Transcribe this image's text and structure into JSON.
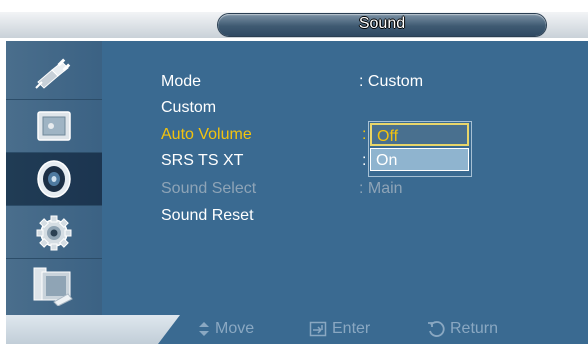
{
  "header": {
    "title": "Sound"
  },
  "sidebar": {
    "items": [
      {
        "icon": "input-plug-icon"
      },
      {
        "icon": "picture-icon"
      },
      {
        "icon": "speaker-icon",
        "active": true
      },
      {
        "icon": "setup-gear-icon"
      },
      {
        "icon": "multi-control-icon"
      }
    ]
  },
  "menu": {
    "rows": [
      {
        "label": "Mode",
        "value": ": Custom"
      },
      {
        "label": "Custom",
        "value": ""
      },
      {
        "label": "Auto Volume",
        "value": ":"
      },
      {
        "label": "SRS TS XT",
        "value": ":"
      },
      {
        "label": "Sound Select",
        "value": ": Main"
      },
      {
        "label": "Sound Reset",
        "value": ""
      }
    ]
  },
  "dropdown": {
    "options": [
      "Off",
      "On"
    ],
    "selected": "Off"
  },
  "footer": {
    "move": "Move",
    "enter": "Enter",
    "return": "Return"
  },
  "colors": {
    "panel": "#3a6a91",
    "highlight": "#f3c30e",
    "disabled": "#8ea4b7"
  }
}
